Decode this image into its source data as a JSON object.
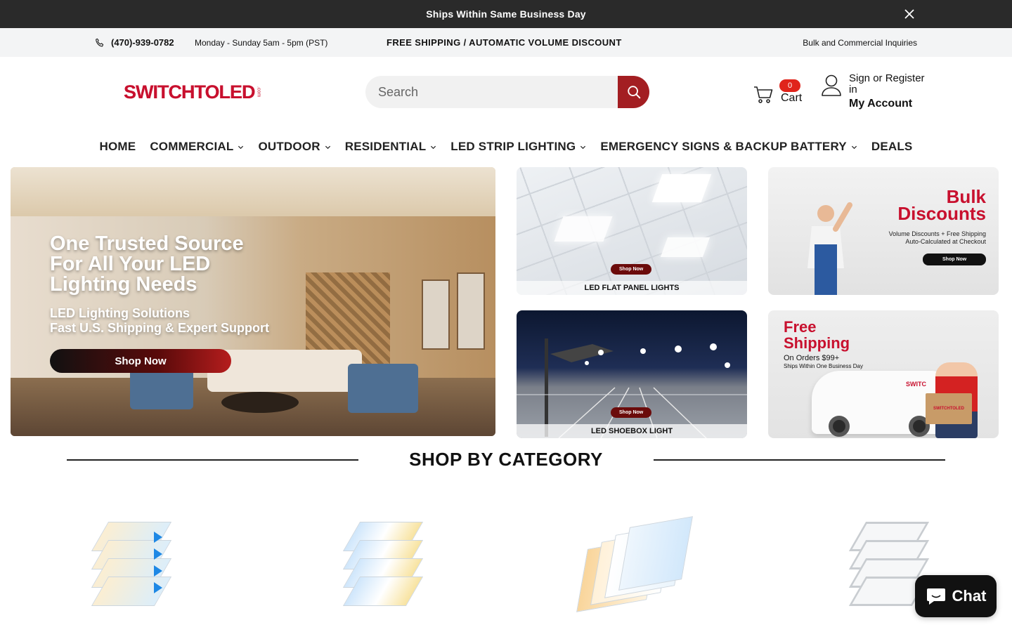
{
  "announcement": {
    "text": "Ships Within Same Business Day"
  },
  "infobar": {
    "phone": "(470)-939-0782",
    "hours": "Monday - Sunday 5am - 5pm (PST)",
    "shipping": "FREE SHIPPING / AUTOMATIC VOLUME DISCOUNT",
    "bulk_link": "Bulk and Commercial Inquiries"
  },
  "header": {
    "logo_text": "SWITCHTOLED",
    "logo_suffix": ".com",
    "search_placeholder": "Search",
    "cart_count": "0",
    "cart_label": "Cart",
    "account_signin": "Sign or Register in",
    "account_label": "My Account"
  },
  "nav": {
    "items": [
      {
        "label": "HOME",
        "dropdown": false
      },
      {
        "label": "COMMERCIAL",
        "dropdown": true
      },
      {
        "label": "OUTDOOR",
        "dropdown": true
      },
      {
        "label": "RESIDENTIAL",
        "dropdown": true
      },
      {
        "label": "LED STRIP LIGHTING",
        "dropdown": true
      },
      {
        "label": "EMERGENCY SIGNS & BACKUP BATTERY",
        "dropdown": true
      },
      {
        "label": "DEALS",
        "dropdown": false
      }
    ]
  },
  "hero": {
    "title": "One Trusted Source For All Your LED Lighting Needs",
    "sub1": "LED Lighting Solutions",
    "sub2": "Fast U.S. Shipping & Expert Support",
    "cta": "Shop Now"
  },
  "tiles": {
    "flat_panel": {
      "cta": "Shop Now",
      "caption": "LED FLAT PANEL LIGHTS"
    },
    "bulk": {
      "title1": "Bulk",
      "title2": "Discounts",
      "line1": "Volume Discounts + Free Shipping",
      "line2": "Auto-Calculated at Checkout",
      "cta": "Shop Now"
    },
    "shoebox": {
      "cta": "Shop Now",
      "caption": "LED SHOEBOX LIGHT"
    },
    "free_shipping": {
      "title1": "Free",
      "title2": "Shipping",
      "line1": "On Orders $99+",
      "line2": "Ships Within One Business Day",
      "van_text": "SWITC",
      "box_text": "SWITCHTOLED"
    }
  },
  "categories": {
    "heading": "SHOP BY CATEGORY"
  },
  "chat": {
    "label": "Chat"
  },
  "colors": {
    "brand_red": "#c8102e",
    "search_button": "#a31e22",
    "badge": "#e0241b",
    "topbar": "#2a2a2a"
  }
}
